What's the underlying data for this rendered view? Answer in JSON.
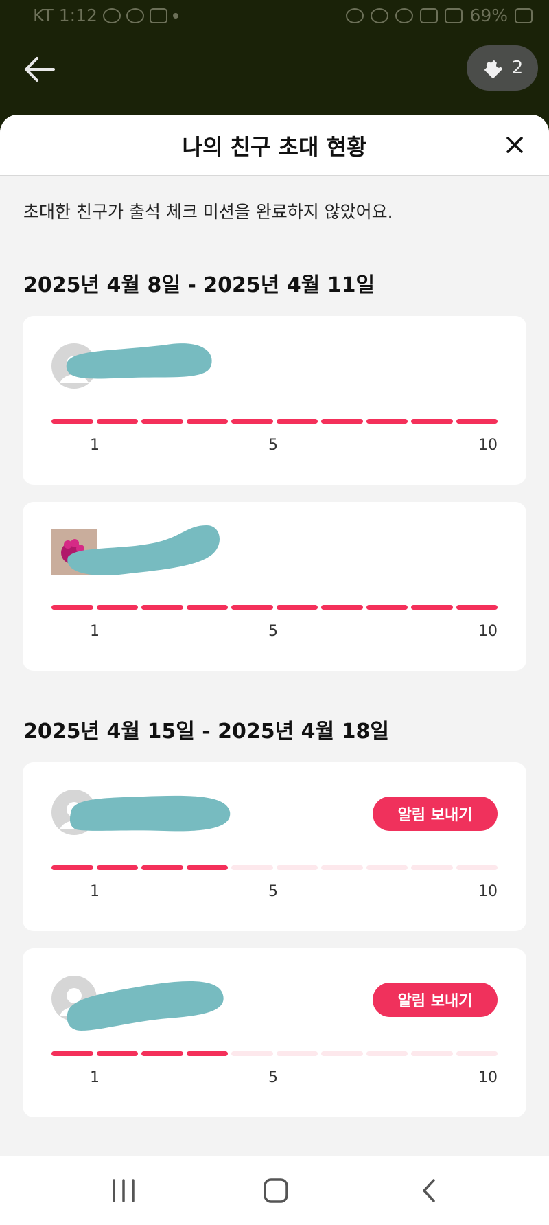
{
  "status_bar": {
    "carrier": "KT",
    "time": "1:12",
    "battery": "69%"
  },
  "header": {
    "badge_count": "2"
  },
  "sheet": {
    "title": "나의 친구 초대 현황",
    "notice": "초대한 친구가 출석 체크 미션을 완료하지 않았어요."
  },
  "groups": [
    {
      "period": "2025년 4월 8일 - 2025년 4월 11일",
      "friends": [
        {
          "completed": 10,
          "total": 10,
          "ticks": [
            "1",
            "5",
            "10"
          ]
        },
        {
          "completed": 10,
          "total": 10,
          "ticks": [
            "1",
            "5",
            "10"
          ]
        }
      ]
    },
    {
      "period": "2025년 4월 15일 - 2025년 4월 18일",
      "friends": [
        {
          "completed": 4,
          "total": 10,
          "ticks": [
            "1",
            "5",
            "10"
          ],
          "notify_label": "알림 보내기"
        },
        {
          "completed": 4,
          "total": 10,
          "ticks": [
            "1",
            "5",
            "10"
          ],
          "notify_label": "알림 보내기"
        }
      ]
    }
  ],
  "colors": {
    "accent": "#f0315c",
    "progress_on": "#f4305a",
    "progress_off": "#fde8ec",
    "redaction": "#77bbc0",
    "header_bg": "#1a2208"
  },
  "icons": {
    "back": "arrow-left-icon",
    "badge": "puzzle-icon",
    "close": "close-icon",
    "recents": "recent-apps-icon",
    "home": "home-icon",
    "nav_back": "nav-back-icon"
  }
}
